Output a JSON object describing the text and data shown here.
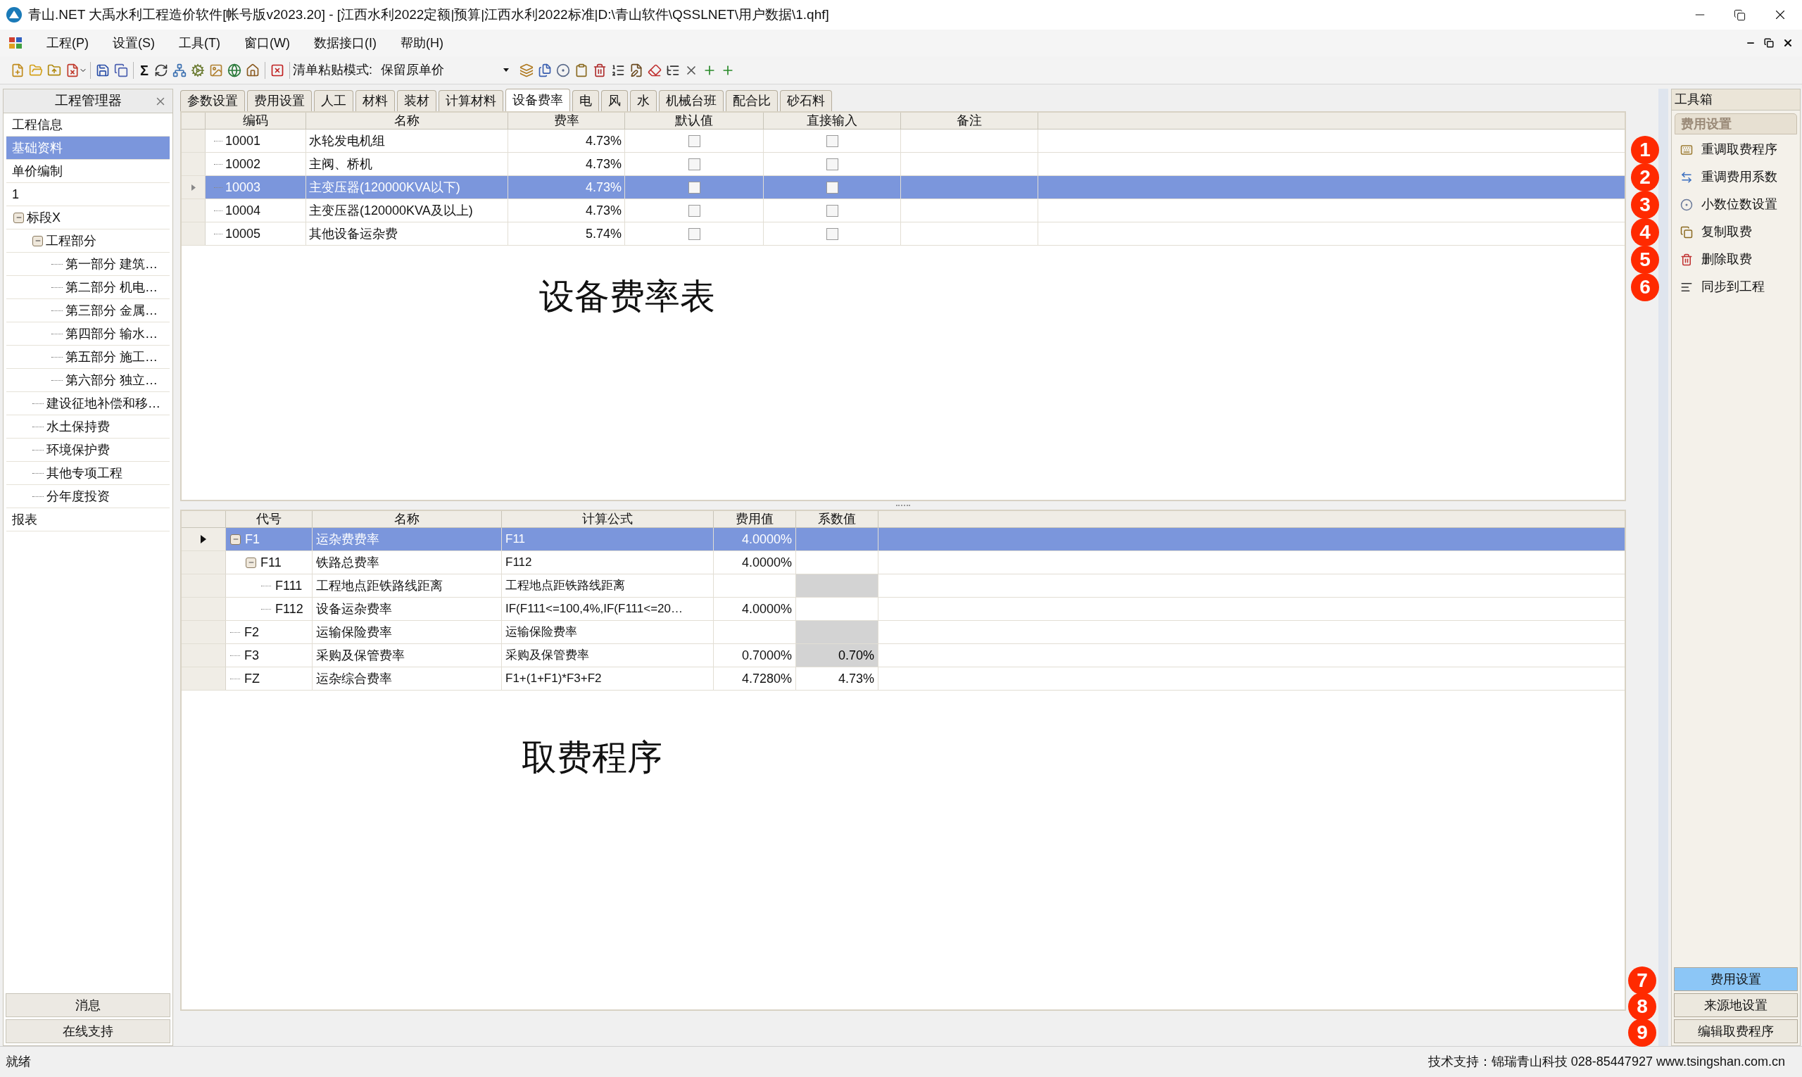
{
  "window": {
    "title": "青山.NET 大禹水利工程造价软件[帐号版v2023.20] - [江西水利2022定额|预算|江西水利2022标准|D:\\青山软件\\QSSLNET\\用户数据\\1.qhf]"
  },
  "menu": [
    "工程(P)",
    "设置(S)",
    "工具(T)",
    "窗口(W)",
    "数据接口(I)",
    "帮助(H)"
  ],
  "toolbar": {
    "sum_symbol": "Σ",
    "paste_mode_label": "清单粘贴模式:",
    "paste_mode_value": "保留原单价"
  },
  "left_panel": {
    "title": "工程管理器",
    "items": [
      {
        "kind": "plain",
        "label": "工程信息",
        "selected": false
      },
      {
        "kind": "plain",
        "label": "基础资料",
        "selected": true
      },
      {
        "kind": "plain",
        "label": "单价编制",
        "selected": false
      },
      {
        "kind": "plain",
        "label": "1",
        "selected": false
      },
      {
        "kind": "tree",
        "nodes": [
          {
            "label": "标段X",
            "expanded": true,
            "children": [
              {
                "label": "工程部分",
                "expanded": true,
                "children": [
                  {
                    "label": "第一部分 建筑…"
                  },
                  {
                    "label": "第二部分 机电…"
                  },
                  {
                    "label": "第三部分 金属…"
                  },
                  {
                    "label": "第四部分 输水…"
                  },
                  {
                    "label": "第五部分 施工…"
                  },
                  {
                    "label": "第六部分 独立…"
                  }
                ]
              },
              {
                "label": "建设征地补偿和移…"
              },
              {
                "label": "水土保持费"
              },
              {
                "label": "环境保护费"
              },
              {
                "label": "其他专项工程"
              },
              {
                "label": "分年度投资"
              }
            ]
          }
        ]
      },
      {
        "kind": "plain",
        "label": "报表",
        "selected": false
      }
    ],
    "bottom_buttons": [
      "消息",
      "在线支持"
    ]
  },
  "tabs": [
    {
      "label": "参数设置",
      "selected": false
    },
    {
      "label": "费用设置",
      "selected": false
    },
    {
      "label": "人工",
      "selected": false
    },
    {
      "label": "材料",
      "selected": false
    },
    {
      "label": "装材",
      "selected": false
    },
    {
      "label": "计算材料",
      "selected": false
    },
    {
      "label": "设备费率",
      "selected": true
    },
    {
      "label": "电",
      "selected": false
    },
    {
      "label": "风",
      "selected": false
    },
    {
      "label": "水",
      "selected": false
    },
    {
      "label": "机械台班",
      "selected": false
    },
    {
      "label": "配合比",
      "selected": false
    },
    {
      "label": "砂石料",
      "selected": false
    }
  ],
  "rate_table": {
    "overlay_label": "设备费率表",
    "columns": [
      "编码",
      "名称",
      "费率",
      "默认值",
      "直接输入",
      "备注"
    ],
    "rows": [
      {
        "code": "10001",
        "name": "水轮发电机组",
        "rate": "4.73%",
        "default": false,
        "direct_input": false,
        "selected": false
      },
      {
        "code": "10002",
        "name": "主阀、桥机",
        "rate": "4.73%",
        "default": false,
        "direct_input": false,
        "selected": false
      },
      {
        "code": "10003",
        "name": "主变压器(120000KVA以下)",
        "rate": "4.73%",
        "default": false,
        "direct_input": false,
        "selected": true
      },
      {
        "code": "10004",
        "name": "主变压器(120000KVA及以上)",
        "rate": "4.73%",
        "default": false,
        "direct_input": false,
        "selected": false
      },
      {
        "code": "10005",
        "name": "其他设备运杂费",
        "rate": "5.74%",
        "default": false,
        "direct_input": false,
        "selected": false
      }
    ]
  },
  "fee_table": {
    "overlay_label": "取费程序",
    "columns": [
      "代号",
      "名称",
      "计算公式",
      "费用值",
      "系数值"
    ],
    "rows": [
      {
        "code": "F1",
        "name": "运杂费费率",
        "formula": "F11",
        "fee": "4.0000%",
        "selected": true,
        "expanded": true,
        "coef_locked": false,
        "children": [
          {
            "code": "F11",
            "name": "铁路总费率",
            "formula": "F112",
            "fee": "4.0000%",
            "selected": false,
            "expanded": true,
            "coef_locked": false,
            "children": [
              {
                "code": "F111",
                "name": "工程地点距铁路线距离",
                "formula": "工程地点距铁路线距离",
                "selected": false,
                "coef_locked": true
              },
              {
                "code": "F112",
                "name": "设备运杂费率",
                "formula": "IF(F111<=100,4%,IF(F111<=20…",
                "fee": "4.0000%",
                "selected": false,
                "coef_locked": false
              }
            ]
          }
        ]
      },
      {
        "code": "F2",
        "name": "运输保险费率",
        "formula": "运输保险费率",
        "selected": false,
        "coef_locked": true
      },
      {
        "code": "F3",
        "name": "采购及保管费率",
        "formula": "采购及保管费率",
        "fee": "0.7000%",
        "coef": "0.70%",
        "selected": false,
        "coef_locked": true
      },
      {
        "code": "FZ",
        "name": "运杂综合费率",
        "formula": "F1+(1+F1)*F3+F2",
        "fee": "4.7280%",
        "coef": "4.73%",
        "selected": false,
        "coef_locked": false
      }
    ]
  },
  "toolbox": {
    "title": "工具箱",
    "section": "费用设置",
    "items": [
      {
        "label": "重调取费程序",
        "marker": "1"
      },
      {
        "label": "重调费用系数",
        "marker": "2"
      },
      {
        "label": "小数位数设置",
        "marker": "3"
      },
      {
        "label": "复制取费",
        "marker": "4"
      },
      {
        "label": "删除取费",
        "marker": "5"
      },
      {
        "label": "同步到工程",
        "marker": "6"
      }
    ],
    "bottom_buttons": [
      {
        "label": "费用设置",
        "selected": true,
        "marker": "7"
      },
      {
        "label": "来源地设置",
        "selected": false,
        "marker": "8"
      },
      {
        "label": "编辑取费程序",
        "selected": false,
        "marker": "9"
      }
    ]
  },
  "status_bar": {
    "left": "就绪",
    "right": "技术支持：锦瑞青山科技 028-85447927 www.tsingshan.com.cn"
  }
}
